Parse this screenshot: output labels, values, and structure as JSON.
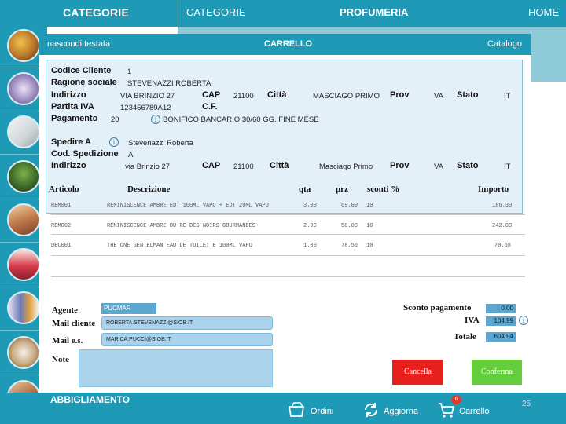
{
  "header": {
    "categorie_bold": "CATEGORIE",
    "categorie": "CATEGORIE",
    "profumeria": "PROFUMERIA",
    "home": "HOME"
  },
  "panel": {
    "hide_header": "nascondi testata",
    "title": "CARRELLO",
    "catalog": "Catalogo"
  },
  "customer": {
    "code_label": "Codice Cliente",
    "code": "1",
    "name_label": "Ragione sociale",
    "name": "STEVENAZZI ROBERTA",
    "address_label": "Indirizzo",
    "address": "VIA BRINZIO 27",
    "cap_label": "CAP",
    "cap": "21100",
    "city_label": "Città",
    "city": "MASCIAGO PRIMO",
    "prov_label": "Prov",
    "prov": "VA",
    "state_label": "Stato",
    "state": "IT",
    "vat_label": "Partita IVA",
    "vat": "123456789A12",
    "cf_label": "C.F.",
    "payment_label": "Pagamento",
    "payment_code": "20",
    "payment_desc": "BONIFICO BANCARIO 30/60 GG. FINE MESE"
  },
  "shipping": {
    "ship_to_label": "Spedire A",
    "ship_to": "Stevenazzi Roberta",
    "ship_code_label": "Cod. Spedizione",
    "ship_code": "A",
    "address_label": "Indirizzo",
    "address": "via Brinzio 27",
    "cap_label": "CAP",
    "cap": "21100",
    "city_label": "Città",
    "city": "Masciago Primo",
    "prov_label": "Prov",
    "prov": "VA",
    "state_label": "Stato",
    "state": "IT"
  },
  "table": {
    "headers": {
      "article": "Articolo",
      "description": "Descrizione",
      "qty": "qta",
      "price": "prz",
      "discount": "sconti %",
      "amount": "Importo"
    },
    "rows": [
      {
        "code": "REM001",
        "desc": "REMINISCENCE AMBRE EDT 100ML VAPO + EDT 20ML VAPO",
        "qty": "3.00",
        "price": "69.00",
        "disc": "10",
        "amount": "186.30"
      },
      {
        "code": "REM002",
        "desc": "REMINISCENCE AMBRE DU RE DES NOIRS GOURMANDES",
        "qty": "2.00",
        "price": "50.00",
        "disc": "10",
        "amount": "242.00"
      },
      {
        "code": "DEC001",
        "desc": "THE ONE GENTELMAN EAU DE TOILETTE 100ML VAPO",
        "qty": "1.00",
        "price": "78.50",
        "disc": "10",
        "amount": "70.65"
      }
    ]
  },
  "footer_form": {
    "agent_label": "Agente",
    "agent": "PUCMAR",
    "mail_client_label": "Mail cliente",
    "mail_client": "ROBERTA.STEVENAZZI@SIOB.IT",
    "mail_es_label": "Mail e.s.",
    "mail_es": "MARICA.PUCCI@SIOB.IT",
    "notes_label": "Note",
    "notes": "",
    "discount_label": "Sconto pagamento",
    "discount": "0.00",
    "vat_label": "IVA",
    "vat": "104.99",
    "total_label": "Totale",
    "total": "604.94",
    "cancel": "Cancella",
    "confirm": "Conferma"
  },
  "bottom": {
    "category": "ABBIGLIAMENTO",
    "orders": "Ordini",
    "update": "Aggiorna",
    "cart": "Carrello",
    "cart_count": "6",
    "page": "25"
  },
  "colors": {
    "brand": "#1e9ab7",
    "info_bg": "#e4f0f8",
    "cancel": "#e8201d",
    "confirm": "#63cd3b"
  }
}
